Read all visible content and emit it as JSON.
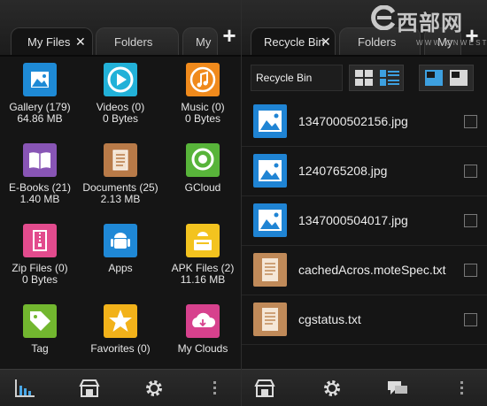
{
  "left": {
    "tabs": [
      {
        "label": "My Files",
        "close": "✕"
      },
      {
        "label": "Folders"
      },
      {
        "label": "My"
      }
    ],
    "add_tab": "+",
    "grid": [
      {
        "label": "Gallery (179)",
        "sub": "64.86 MB",
        "icon": "gallery-icon",
        "color": "#1e8ad6"
      },
      {
        "label": "Videos (0)",
        "sub": "0 Bytes",
        "icon": "video-icon",
        "color": "#22b1d8"
      },
      {
        "label": "Music (0)",
        "sub": "0 Bytes",
        "icon": "music-icon",
        "color": "#f08a1c"
      },
      {
        "label": "E-Books (21)",
        "sub": "1.40 MB",
        "icon": "ebook-icon",
        "color": "#8855b5"
      },
      {
        "label": "Documents (25)",
        "sub": "2.13 MB",
        "icon": "documents-icon",
        "color": "#b87a48"
      },
      {
        "label": "GCloud",
        "sub": "",
        "icon": "gcloud-icon",
        "color": "#58b43a"
      },
      {
        "label": "Zip Files (0)",
        "sub": "0 Bytes",
        "icon": "zip-icon",
        "color": "#e24b8d"
      },
      {
        "label": "Apps",
        "sub": "",
        "icon": "android-icon",
        "color": "#1f88d6"
      },
      {
        "label": "APK Files (2)",
        "sub": "11.16 MB",
        "icon": "apk-icon",
        "color": "#f3c31f"
      },
      {
        "label": "Tag",
        "sub": "",
        "icon": "tag-icon",
        "color": "#72b72f"
      },
      {
        "label": "Favorites (0)",
        "sub": "",
        "icon": "star-icon",
        "color": "#f2b21a"
      },
      {
        "label": "My Clouds",
        "sub": "",
        "icon": "cloud-icon",
        "color": "#d7418d"
      }
    ]
  },
  "right": {
    "tabs": [
      {
        "label": "Recycle Bin",
        "close": "✕"
      },
      {
        "label": "Folders"
      },
      {
        "label": "My"
      }
    ],
    "add_tab": "+",
    "location": "Recycle Bin",
    "files": [
      {
        "name": "1347000502156.jpg",
        "icon": "image-file-icon"
      },
      {
        "name": "1240765208.jpg",
        "icon": "image-file-icon"
      },
      {
        "name": "1347000504017.jpg",
        "icon": "image-file-icon"
      },
      {
        "name": "cachedAcros.moteSpec.txt",
        "icon": "text-file-icon"
      },
      {
        "name": "cgstatus.txt",
        "icon": "text-file-icon"
      }
    ]
  },
  "watermark": {
    "title": "西部网",
    "sub": "W W W . C N W E S T . N E"
  }
}
